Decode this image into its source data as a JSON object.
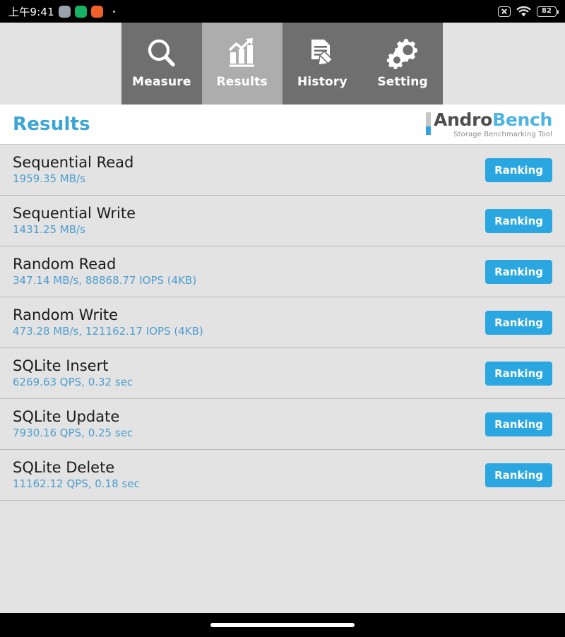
{
  "status_bar": {
    "clock": "上午9:41",
    "app_icons": [
      "gray-app-icon",
      "green-app-icon",
      "orange-app-icon"
    ],
    "overflow_dot": "·",
    "mute_icon": "mute-icon",
    "wifi_icon": "wifi-icon",
    "battery_level": "82"
  },
  "tabs": [
    {
      "label": "Measure",
      "icon": "magnifier-icon",
      "active": false
    },
    {
      "label": "Results",
      "icon": "bar-chart-arrow-icon",
      "active": true
    },
    {
      "label": "History",
      "icon": "document-pencil-icon",
      "active": false
    },
    {
      "label": "Setting",
      "icon": "gears-icon",
      "active": false
    }
  ],
  "header": {
    "title": "Results",
    "logo_andro": "Andro",
    "logo_bench": "Bench",
    "logo_subtitle": "Storage Benchmarking Tool"
  },
  "results": [
    {
      "title": "Sequential Read",
      "value": "1959.35 MB/s",
      "button": "Ranking"
    },
    {
      "title": "Sequential Write",
      "value": "1431.25 MB/s",
      "button": "Ranking"
    },
    {
      "title": "Random Read",
      "value": "347.14 MB/s, 88868.77 IOPS (4KB)",
      "button": "Ranking"
    },
    {
      "title": "Random Write",
      "value": "473.28 MB/s, 121162.17 IOPS (4KB)",
      "button": "Ranking"
    },
    {
      "title": "SQLite Insert",
      "value": "6269.63 QPS, 0.32 sec",
      "button": "Ranking"
    },
    {
      "title": "SQLite Update",
      "value": "7930.16 QPS, 0.25 sec",
      "button": "Ranking"
    },
    {
      "title": "SQLite Delete",
      "value": "11162.12 QPS, 0.18 sec",
      "button": "Ranking"
    }
  ],
  "colors": {
    "accent_blue": "#2aa7e0",
    "value_blue": "#4d9ed0",
    "tab_inactive": "#6f6f6f",
    "tab_active": "#adadad",
    "row_bg": "#e3e3e3"
  },
  "nav_bar": {
    "home_indicator": "home-indicator"
  }
}
